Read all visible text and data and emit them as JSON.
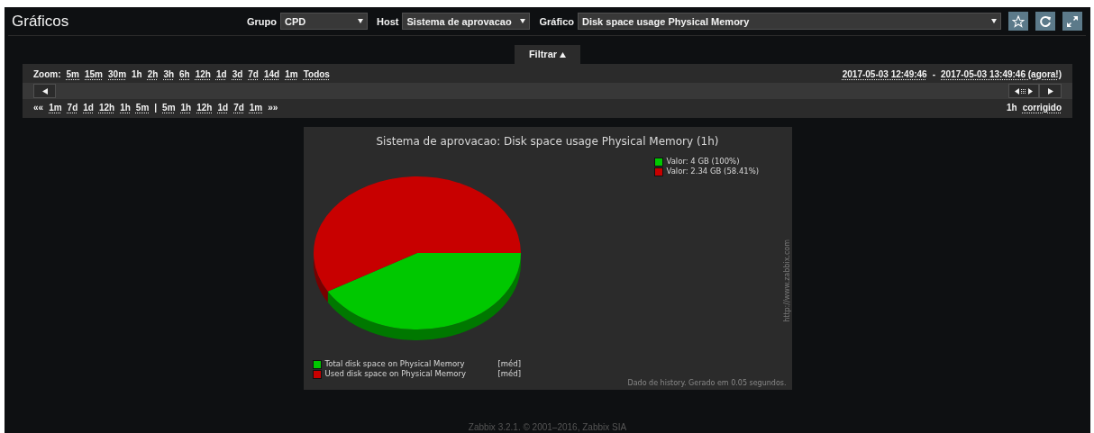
{
  "header": {
    "title": "Gráficos",
    "filters": [
      {
        "label": "Grupo",
        "value": "CPD"
      },
      {
        "label": "Host",
        "value": "Sistema de aprovacao"
      },
      {
        "label": "Gráfico",
        "value": "Disk space usage Physical Memory"
      }
    ]
  },
  "filter_tab": {
    "label": "Filtrar",
    "expanded": true
  },
  "zoom": {
    "label": "Zoom:",
    "items": [
      {
        "label": "5m",
        "selected": false
      },
      {
        "label": "15m",
        "selected": false
      },
      {
        "label": "30m",
        "selected": false
      },
      {
        "label": "1h",
        "selected": true
      },
      {
        "label": "2h",
        "selected": false
      },
      {
        "label": "3h",
        "selected": false
      },
      {
        "label": "6h",
        "selected": false
      },
      {
        "label": "12h",
        "selected": false
      },
      {
        "label": "1d",
        "selected": false
      },
      {
        "label": "3d",
        "selected": false
      },
      {
        "label": "7d",
        "selected": false
      },
      {
        "label": "14d",
        "selected": false
      },
      {
        "label": "1m",
        "selected": false
      },
      {
        "label": "Todos",
        "selected": false
      }
    ]
  },
  "period": {
    "from": "2017-05-03 12:49:46",
    "separator": "-",
    "to": "2017-05-03 13:49:46 (agora!)"
  },
  "nav": [
    {
      "kind": "text",
      "label": "««"
    },
    {
      "kind": "link",
      "label": "1m"
    },
    {
      "kind": "link",
      "label": "7d"
    },
    {
      "kind": "link",
      "label": "1d"
    },
    {
      "kind": "link",
      "label": "12h"
    },
    {
      "kind": "link",
      "label": "1h"
    },
    {
      "kind": "link",
      "label": "5m"
    },
    {
      "kind": "text",
      "label": "|"
    },
    {
      "kind": "link",
      "label": "5m"
    },
    {
      "kind": "link",
      "label": "1h"
    },
    {
      "kind": "link",
      "label": "12h"
    },
    {
      "kind": "link",
      "label": "1d"
    },
    {
      "kind": "link",
      "label": "7d"
    },
    {
      "kind": "link",
      "label": "1m"
    },
    {
      "kind": "text",
      "label": "»»"
    }
  ],
  "period_mode": {
    "length": "1h",
    "mode": "corrigido"
  },
  "graph": {
    "title": "Sistema de aprovacao: Disk space usage Physical Memory (1h)",
    "values_legend": [
      {
        "text": "Valor: 4 GB (100%)",
        "color": "#00c800"
      },
      {
        "text": "Valor: 2.34 GB (58.41%)",
        "color": "#c80000"
      }
    ],
    "items_legend": [
      {
        "func": "[méd]",
        "color": "#00c800"
      },
      {
        "func": "[méd]",
        "color": "#c80000"
      }
    ],
    "url": "http://www.zabbix.com",
    "footnote": "Dado de history. Gerado em 0.05 segundos.",
    "chart_data": {
      "type": "pie",
      "categories": [
        "Total disk space on Physical Memory",
        "Used disk space on Physical Memory"
      ],
      "values": [
        41.59,
        58.41
      ]
    }
  },
  "footer": "Zabbix 3.2.1. © 2001–2016, Zabbix SIA"
}
